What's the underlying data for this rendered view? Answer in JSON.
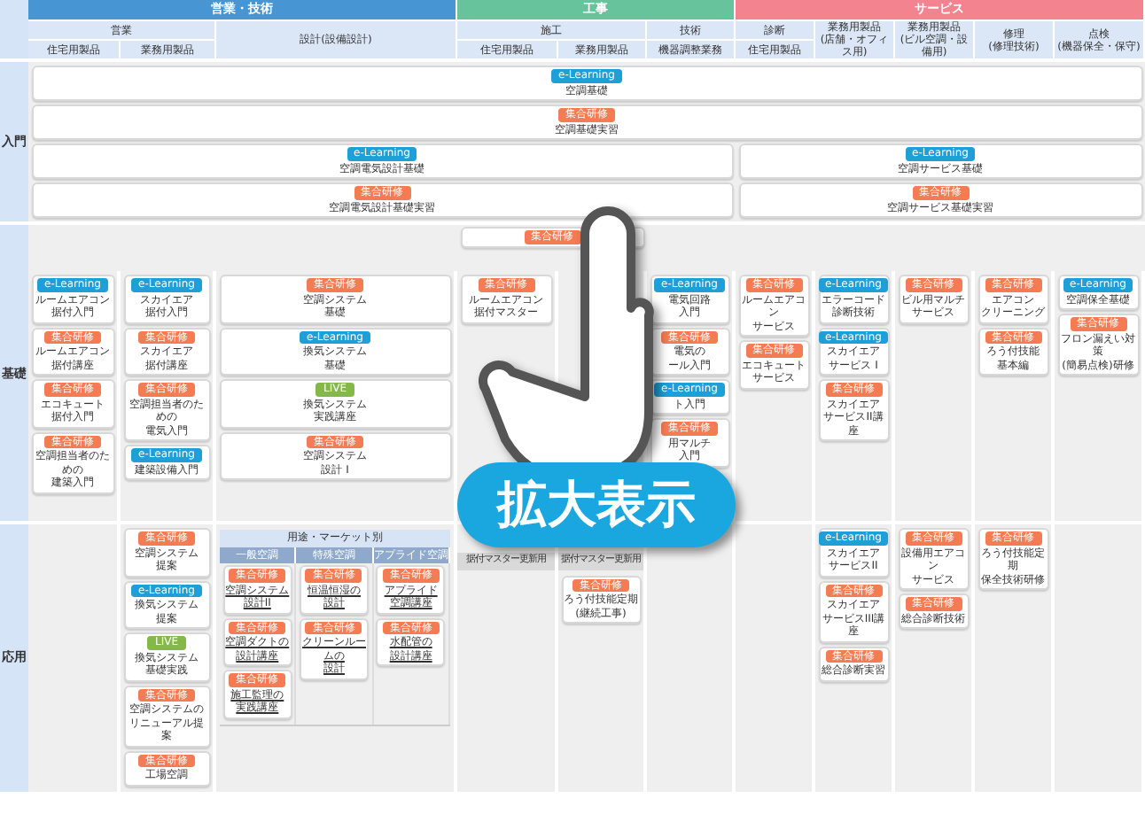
{
  "header": {
    "groups": [
      {
        "name": "営業・技術",
        "color": "#4796d3",
        "subheads": [
          {
            "name": "営業",
            "columns": [
              "住宅用製品",
              "業務用製品"
            ]
          },
          {
            "name": "設計(設備設計)"
          }
        ]
      },
      {
        "name": "工事",
        "color": "#66c39b",
        "subheads": [
          {
            "name": "施工",
            "columns": [
              "住宅用製品",
              "業務用製品"
            ]
          },
          {
            "name": "技術",
            "columns": [
              "機器調整業務"
            ]
          }
        ]
      },
      {
        "name": "サービス",
        "color": "#f2838f",
        "subheads": [
          {
            "name": "診断",
            "columns": [
              "住宅用製品"
            ]
          },
          {
            "name": "業務用製品",
            "note": "(店舗・オフィス用)"
          },
          {
            "name": "業務用製品",
            "note": "(ビル空調・設備用)"
          },
          {
            "name": "修理",
            "note": "(修理技術)"
          },
          {
            "name": "点検",
            "note": "(機器保全・保守)"
          }
        ]
      }
    ]
  },
  "sections": [
    {
      "label": "入門",
      "kind": "entry",
      "rows": [
        {
          "cards": [
            {
              "badge": {
                "kind": "elearning",
                "label": "e-Learning"
              },
              "lines": [
                "空調基礎"
              ]
            }
          ]
        },
        {
          "cards": [
            {
              "badge": {
                "kind": "group",
                "label": "集合研修"
              },
              "lines": [
                "空調基礎実習"
              ]
            }
          ]
        },
        {
          "cards": [
            {
              "badge": {
                "kind": "elearning",
                "label": "e-Learning"
              },
              "lines": [
                "空調電気設計基礎"
              ]
            },
            {
              "badge": {
                "kind": "elearning",
                "label": "e-Learning"
              },
              "lines": [
                "空調サービス基礎"
              ]
            }
          ]
        },
        {
          "cards": [
            {
              "badge": {
                "kind": "group",
                "label": "集合研修"
              },
              "lines": [
                "空調電気設計基礎実習"
              ]
            },
            {
              "badge": {
                "kind": "group",
                "label": "集合研修"
              },
              "lines": [
                "空調サービス基礎実習"
              ]
            }
          ]
        }
      ]
    },
    {
      "label": "基礎",
      "kind": "grid",
      "top_card": {
        "badge": {
          "kind": "group",
          "label": "集合研修"
        }
      },
      "columns": [
        {
          "items": [
            {
              "kind": "card",
              "badge": {
                "kind": "elearning",
                "label": "e-Learning"
              },
              "lines": [
                "ルームエアコン",
                "据付入門"
              ]
            },
            {
              "kind": "card",
              "badge": {
                "kind": "group",
                "label": "集合研修"
              },
              "lines": [
                "ルームエアコン",
                "据付講座"
              ]
            },
            {
              "kind": "card",
              "badge": {
                "kind": "group",
                "label": "集合研修"
              },
              "lines": [
                "エコキュート",
                "据付入門"
              ]
            },
            {
              "kind": "card",
              "badge": {
                "kind": "group",
                "label": "集合研修"
              },
              "lines": [
                "空調担当者のための",
                "建築入門"
              ]
            }
          ]
        },
        {
          "items": [
            {
              "kind": "card",
              "badge": {
                "kind": "elearning",
                "label": "e-Learning"
              },
              "lines": [
                "スカイエア",
                "据付入門"
              ]
            },
            {
              "kind": "card",
              "badge": {
                "kind": "group",
                "label": "集合研修"
              },
              "lines": [
                "スカイエア",
                "据付講座"
              ]
            },
            {
              "kind": "card",
              "badge": {
                "kind": "group",
                "label": "集合研修"
              },
              "lines": [
                "空調担当者のための",
                "電気入門"
              ]
            },
            {
              "kind": "card",
              "badge": {
                "kind": "elearning",
                "label": "e-Learning"
              },
              "lines": [
                "建築設備入門"
              ]
            }
          ]
        },
        {
          "items": [
            {
              "kind": "card",
              "badge": {
                "kind": "group",
                "label": "集合研修"
              },
              "lines": [
                "空調システム",
                "基礎"
              ]
            },
            {
              "kind": "card",
              "badge": {
                "kind": "elearning",
                "label": "e-Learning"
              },
              "lines": [
                "換気システム",
                "基礎"
              ]
            },
            {
              "kind": "card",
              "badge": {
                "kind": "live",
                "label": "LIVE"
              },
              "lines": [
                "換気システム",
                "実践講座"
              ]
            },
            {
              "kind": "card",
              "badge": {
                "kind": "group",
                "label": "集合研修"
              },
              "lines": [
                "空調システム",
                "設計 I"
              ]
            }
          ]
        },
        {
          "items": [
            {
              "kind": "card",
              "badge": {
                "kind": "group",
                "label": "集合研修"
              },
              "lines": [
                "ルームエアコン",
                "据付マスター"
              ]
            }
          ]
        },
        {},
        {
          "items": [
            {
              "kind": "card",
              "badge": {
                "kind": "elearning",
                "label": "e-Learning"
              },
              "lines": [
                "電気回路",
                "入門"
              ]
            },
            {
              "kind": "card",
              "badge": {
                "kind": "group",
                "label": "集合研修"
              },
              "lines": [
                "電気の",
                "ール入門"
              ]
            },
            {
              "kind": "card",
              "badge": {
                "kind": "elearning",
                "label": "e-Learning"
              },
              "lines": [
                "ト入門"
              ]
            },
            {
              "kind": "card",
              "badge": {
                "kind": "group",
                "label": "集合研修"
              },
              "lines": [
                "用マルチ",
                "入門"
              ]
            }
          ]
        },
        {
          "items": [
            {
              "kind": "card",
              "badge": {
                "kind": "group",
                "label": "集合研修"
              },
              "lines": [
                "ルームエアコン",
                "サービス"
              ]
            },
            {
              "kind": "card",
              "badge": {
                "kind": "group",
                "label": "集合研修"
              },
              "lines": [
                "エコキュート",
                "サービス"
              ]
            }
          ]
        },
        {
          "items": [
            {
              "kind": "card",
              "badge": {
                "kind": "elearning",
                "label": "e-Learning"
              },
              "lines": [
                "エラーコード",
                "診断技術"
              ]
            },
            {
              "kind": "card",
              "badge": {
                "kind": "elearning",
                "label": "e-Learning"
              },
              "lines": [
                "スカイエア",
                "サービス I"
              ]
            },
            {
              "kind": "card",
              "badge": {
                "kind": "group",
                "label": "集合研修"
              },
              "lines": [
                "スカイエア",
                "サービスII講座"
              ]
            }
          ]
        },
        {
          "items": [
            {
              "kind": "card",
              "badge": {
                "kind": "group",
                "label": "集合研修"
              },
              "lines": [
                "ビル用マルチ",
                "サービス"
              ]
            }
          ]
        },
        {
          "items": [
            {
              "kind": "card",
              "badge": {
                "kind": "group",
                "label": "集合研修"
              },
              "lines": [
                "エアコン",
                "クリーニング"
              ]
            },
            {
              "kind": "card",
              "badge": {
                "kind": "group",
                "label": "集合研修"
              },
              "lines": [
                "ろう付技能",
                "基本編"
              ]
            }
          ]
        },
        {
          "items": [
            {
              "kind": "card",
              "badge": {
                "kind": "elearning",
                "label": "e-Learning"
              },
              "lines": [
                "空調保全基礎"
              ]
            },
            {
              "kind": "card",
              "badge": {
                "kind": "group",
                "label": "集合研修"
              },
              "lines": [
                "フロン漏えい対策",
                "(簡易点検)研修"
              ]
            }
          ]
        }
      ]
    },
    {
      "label": "応用",
      "kind": "grid",
      "columns": [
        {},
        {
          "items": [
            {
              "kind": "card",
              "badge": {
                "kind": "group",
                "label": "集合研修"
              },
              "lines": [
                "空調システム",
                "提案"
              ]
            },
            {
              "kind": "card",
              "badge": {
                "kind": "elearning",
                "label": "e-Learning"
              },
              "lines": [
                "換気システム",
                "提案"
              ]
            },
            {
              "kind": "card",
              "badge": {
                "kind": "live",
                "label": "LIVE"
              },
              "lines": [
                "換気システム",
                "基礎実践"
              ]
            },
            {
              "kind": "card",
              "badge": {
                "kind": "group",
                "label": "集合研修"
              },
              "lines": [
                "空調システムの",
                "リニューアル提案"
              ]
            },
            {
              "kind": "card",
              "badge": {
                "kind": "group",
                "label": "集合研修"
              },
              "lines": [
                "工場空調"
              ]
            }
          ]
        },
        {
          "items": [
            {
              "kind": "panel",
              "title": "用途・マーケット別",
              "subcolumns": [
                {
                  "title": "一般空調",
                  "items": [
                    {
                      "kind": "card",
                      "link": true,
                      "badge": {
                        "kind": "group",
                        "label": "集合研修"
                      },
                      "lines": [
                        "空調システム",
                        "設計II"
                      ]
                    },
                    {
                      "kind": "card",
                      "link": true,
                      "badge": {
                        "kind": "group",
                        "label": "集合研修"
                      },
                      "lines": [
                        "空調ダクトの",
                        "設計講座"
                      ]
                    },
                    {
                      "kind": "card",
                      "link": true,
                      "badge": {
                        "kind": "group",
                        "label": "集合研修"
                      },
                      "lines": [
                        "施工監理の",
                        "実践講座"
                      ]
                    }
                  ]
                },
                {
                  "title": "特殊空調",
                  "items": [
                    {
                      "kind": "card",
                      "link": true,
                      "badge": {
                        "kind": "group",
                        "label": "集合研修"
                      },
                      "lines": [
                        "恒温恒湿の",
                        "設計"
                      ]
                    },
                    {
                      "kind": "card",
                      "link": true,
                      "badge": {
                        "kind": "group",
                        "label": "集合研修"
                      },
                      "lines": [
                        "クリーンルームの",
                        "設計"
                      ]
                    }
                  ]
                },
                {
                  "title": "アプライド空調",
                  "items": [
                    {
                      "kind": "card",
                      "link": true,
                      "badge": {
                        "kind": "group",
                        "label": "集合研修"
                      },
                      "lines": [
                        "アプライド",
                        "空調講座"
                      ]
                    },
                    {
                      "kind": "card",
                      "link": true,
                      "badge": {
                        "kind": "group",
                        "label": "集合研修"
                      },
                      "lines": [
                        "水配管の",
                        "設計講座"
                      ]
                    }
                  ]
                }
              ]
            }
          ]
        },
        {
          "items": [
            {
              "kind": "tab",
              "label": "据付マスター更新用"
            }
          ]
        },
        {
          "items": [
            {
              "kind": "tab",
              "label": "据付マスター更新用"
            },
            {
              "kind": "card",
              "badge": {
                "kind": "group",
                "label": "集合研修"
              },
              "lines": [
                "ろう付技能定期",
                "(継続工事)"
              ]
            }
          ]
        },
        {},
        {},
        {
          "items": [
            {
              "kind": "card",
              "badge": {
                "kind": "elearning",
                "label": "e-Learning"
              },
              "lines": [
                "スカイエア",
                "サービスII"
              ]
            },
            {
              "kind": "card",
              "badge": {
                "kind": "group",
                "label": "集合研修"
              },
              "lines": [
                "スカイエア",
                "サービスIII講座"
              ]
            },
            {
              "kind": "card",
              "badge": {
                "kind": "group",
                "label": "集合研修"
              },
              "lines": [
                "総合診断実習"
              ]
            }
          ]
        },
        {
          "items": [
            {
              "kind": "card",
              "badge": {
                "kind": "group",
                "label": "集合研修"
              },
              "lines": [
                "設備用エアコン",
                "サービス"
              ]
            },
            {
              "kind": "card",
              "badge": {
                "kind": "group",
                "label": "集合研修"
              },
              "lines": [
                "総合診断技術"
              ]
            }
          ]
        },
        {
          "items": [
            {
              "kind": "card",
              "badge": {
                "kind": "group",
                "label": "集合研修"
              },
              "lines": [
                "ろう付技能定期",
                "保全技術研修"
              ]
            }
          ]
        },
        {}
      ]
    }
  ],
  "overlay": {
    "button": "拡大表示"
  }
}
